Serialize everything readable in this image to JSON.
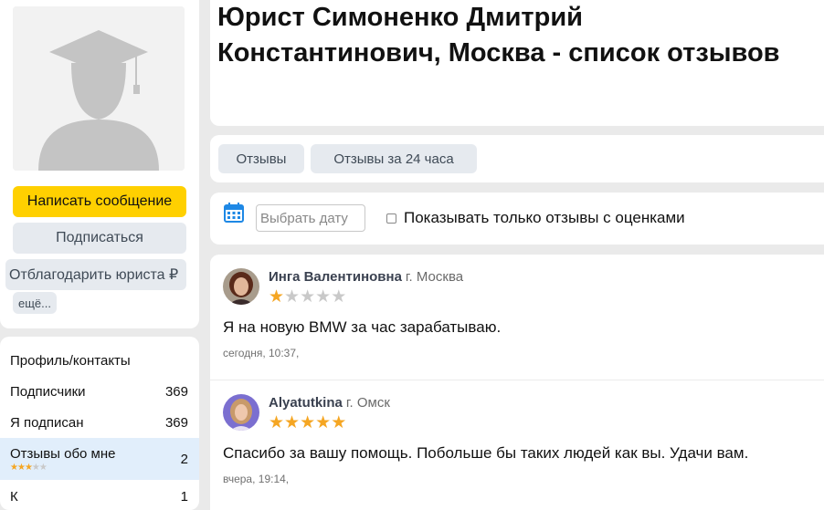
{
  "profile": {
    "avatar_icon": "graduate-placeholder-icon",
    "write_message_label": "Написать сообщение",
    "subscribe_label": "Подписаться",
    "thank_lawyer_label": "Отблагодарить юриста ₽",
    "more_label": "ещё..."
  },
  "nav": {
    "items": [
      {
        "label": "Профиль/контакты",
        "count": ""
      },
      {
        "label": "Подписчики",
        "count": "369"
      },
      {
        "label": "Я подписан",
        "count": "369"
      },
      {
        "label": "Отзывы обо мне",
        "count": "2",
        "rating": 3,
        "max_rating": 5,
        "active": true
      },
      {
        "label": "К",
        "count": "1"
      }
    ]
  },
  "header": {
    "title": "Юрист Симоненко Дмитрий Константинович, Москва - список отзывов"
  },
  "tabs": [
    {
      "label": "Отзывы"
    },
    {
      "label": "Отзывы за 24 часа"
    }
  ],
  "filter": {
    "date_placeholder": "Выбрать дату",
    "rated_only_label": "Показывать только отзывы с оценками",
    "rated_only_checked": false,
    "calendar_icon": "calendar-icon"
  },
  "reviews": [
    {
      "author": "Инга Валентиновна",
      "city": "г. Москва",
      "rating": 1,
      "max_rating": 5,
      "text": "Я на новую BMW за час зарабатываю.",
      "date": "сегодня, 10:37,"
    },
    {
      "author": "Alyatutkina",
      "city": "г. Омск",
      "rating": 5,
      "max_rating": 5,
      "text": "Спасибо за вашу помощь. Побольше бы таких людей как вы. Удачи вам.",
      "date": "вчера, 19:14,"
    }
  ],
  "colors": {
    "accent_yellow": "#ffd000",
    "star_filled": "#f5a623",
    "star_empty": "#c9c9c9",
    "active_nav_bg": "#e1eefb",
    "calendar_blue": "#1e88e5"
  }
}
